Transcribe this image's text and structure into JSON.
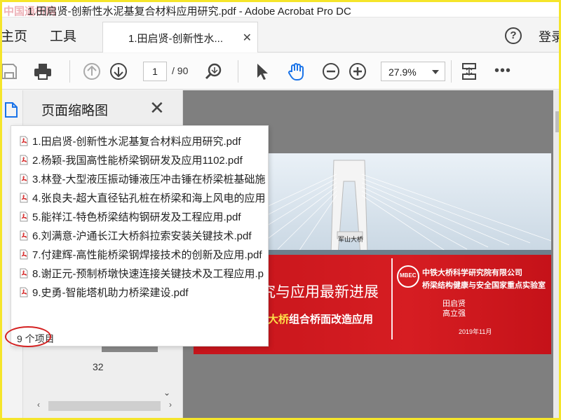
{
  "window": {
    "title": "1.田启贤-创新性水泥基复合材料应用研究.pdf - Adobe Acrobat Pro DC",
    "watermark": "中国通桥网"
  },
  "tabs": {
    "home": "主页",
    "tools": "工具",
    "document": "1.田启贤-创新性水...",
    "login": "登录"
  },
  "toolbar": {
    "page_current": "1",
    "page_total": "/ 90",
    "zoom": "27.9%"
  },
  "thumbnail_panel": {
    "title": "页面缩略图",
    "page_label": "32"
  },
  "file_popup": {
    "items": [
      "1.田启贤-创新性水泥基复合材料应用研究.pdf",
      "2.杨颖-我国高性能桥梁钢研发及应用1102.pdf",
      "3.林登-大型液压振动锤液压冲击锤在桥梁桩基础施",
      "4.张良夫-超大直径钻孔桩在桥梁和海上风电的应用",
      "5.能祥江-特色桥梁结构钢研发及工程应用.pdf",
      "6.刘满意-沪通长江大桥斜拉索安装关键技术.pdf",
      "7.付建辉-高性能桥梁钢焊接技术的创新及应用.pdf",
      "8.谢正元-预制桥墩快速连接关键技术及工程应用.p",
      "9.史勇-智能塔机助力桥梁建设.pdf"
    ],
    "count": "9 个项目"
  },
  "slide": {
    "headline": "究与应用最新进展",
    "subline_highlight": "大桥",
    "subline_rest": "组合桥面改造应用",
    "org_line1": "中铁大桥科学研究院有限公司",
    "org_line2": "桥梁结构健康与安全国家重点实验室",
    "logo_text": "MBEC",
    "author1": "田启贤",
    "author2": "高立强",
    "date": "2019年11月",
    "bridge_sign": "军山大桥"
  },
  "colors": {
    "annotation_circle": "#d42020",
    "hand_tool": "#1a73e8",
    "slide_red": "#d61d22",
    "highlight_text": "#ffe14a"
  },
  "icons": [
    "save-icon",
    "print-icon",
    "prev-page-icon",
    "next-page-icon",
    "zoom-tool-icon",
    "select-arrow-icon",
    "hand-tool-icon",
    "zoom-out-icon",
    "zoom-in-icon",
    "page-fit-icon",
    "more-icon",
    "help-icon",
    "pdf-file-icon",
    "page-thumbnails-icon"
  ]
}
